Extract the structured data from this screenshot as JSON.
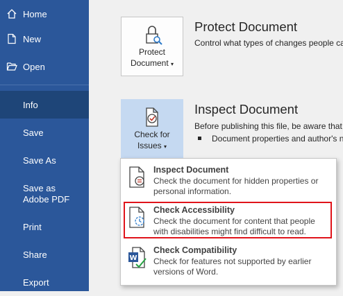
{
  "sidebar": {
    "items": [
      {
        "label": "Home",
        "icon": "home-icon"
      },
      {
        "label": "New",
        "icon": "new-document-icon"
      },
      {
        "label": "Open",
        "icon": "folder-open-icon"
      },
      {
        "label": "Info",
        "active": true
      },
      {
        "label": "Save"
      },
      {
        "label": "Save As"
      },
      {
        "label": "Save as Adobe PDF"
      },
      {
        "label": "Print"
      },
      {
        "label": "Share"
      },
      {
        "label": "Export"
      }
    ],
    "color": "#2b579a",
    "active_color": "#1e4578"
  },
  "protect": {
    "button_label_1": "Protect",
    "button_label_2": "Document",
    "title": "Protect Document",
    "description": "Control what types of changes people ca"
  },
  "inspect": {
    "button_label_1": "Check for",
    "button_label_2": "Issues",
    "title": "Inspect Document",
    "description": "Before publishing this file, be aware that",
    "bullet": "Document properties and author's n"
  },
  "menu": {
    "items": [
      {
        "title": "Inspect Document",
        "description": "Check the document for hidden properties or personal information."
      },
      {
        "title": "Check Accessibility",
        "description": "Check the document for content that people with disabilities might find difficult to read."
      },
      {
        "title": "Check Compatibility",
        "description": "Check for features not supported by earlier versions of Word."
      }
    ],
    "highlight_color": "#e0131a"
  }
}
